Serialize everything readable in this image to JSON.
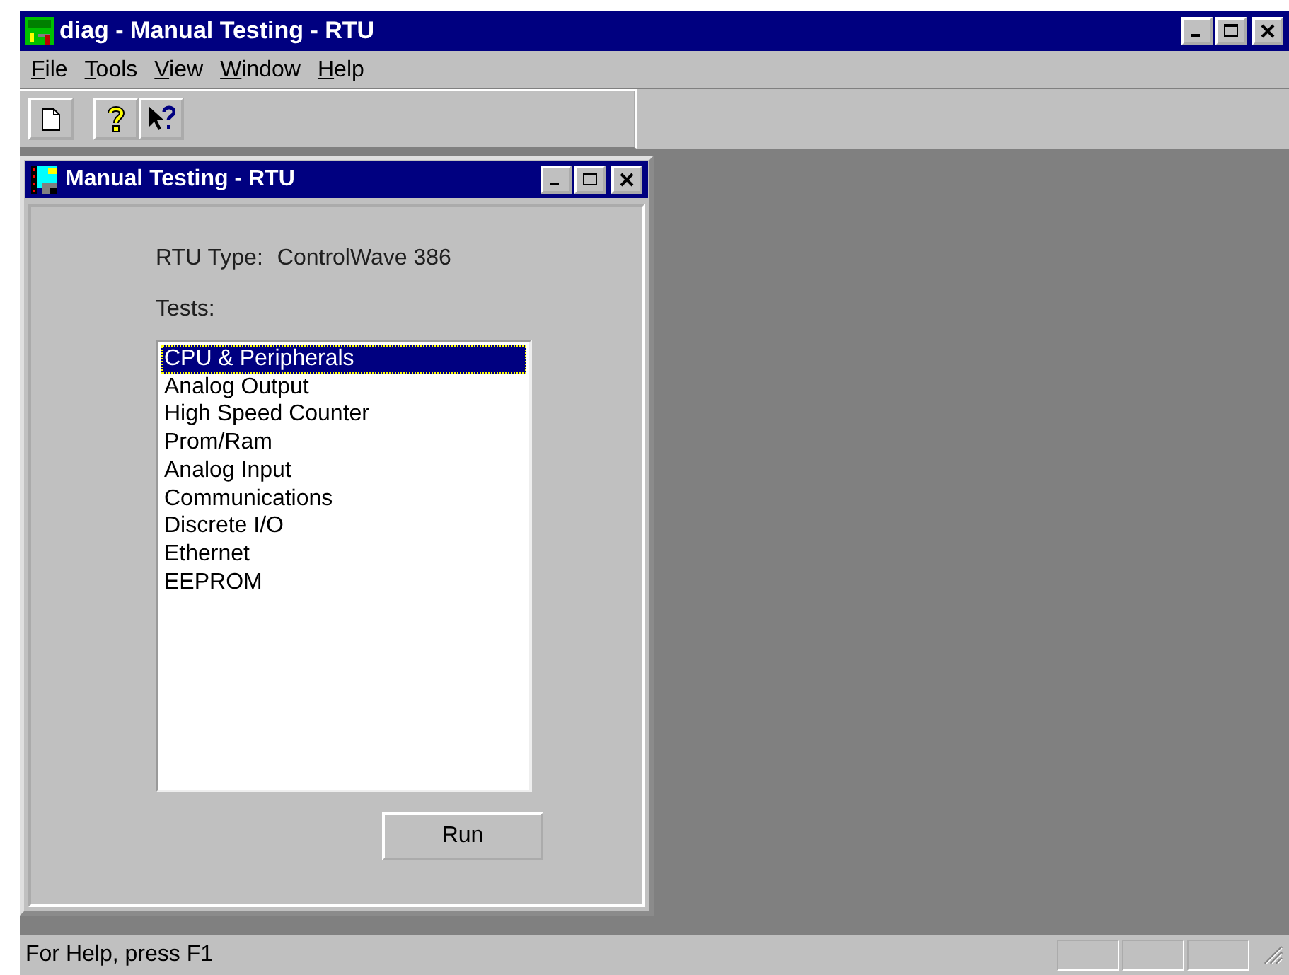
{
  "window": {
    "title": "diag - Manual Testing - RTU"
  },
  "menu": [
    {
      "label": "File"
    },
    {
      "label": "Tools"
    },
    {
      "label": "View"
    },
    {
      "label": "Window"
    },
    {
      "label": "Help"
    }
  ],
  "child_window": {
    "title": "Manual Testing - RTU",
    "rtu_type_label": "RTU Type:",
    "rtu_type_value": "ControlWave 386",
    "tests_label": "Tests:",
    "tests": [
      {
        "label": "CPU & Peripherals",
        "selected": true
      },
      {
        "label": "Analog Output",
        "selected": false
      },
      {
        "label": "High Speed Counter",
        "selected": false
      },
      {
        "label": "Prom/Ram",
        "selected": false
      },
      {
        "label": "Analog Input",
        "selected": false
      },
      {
        "label": "Communications",
        "selected": false
      },
      {
        "label": "Discrete I/O",
        "selected": false
      },
      {
        "label": "Ethernet",
        "selected": false
      },
      {
        "label": "EEPROM",
        "selected": false
      }
    ],
    "run_button": "Run"
  },
  "status_bar": {
    "text": "For Help, press F1"
  }
}
